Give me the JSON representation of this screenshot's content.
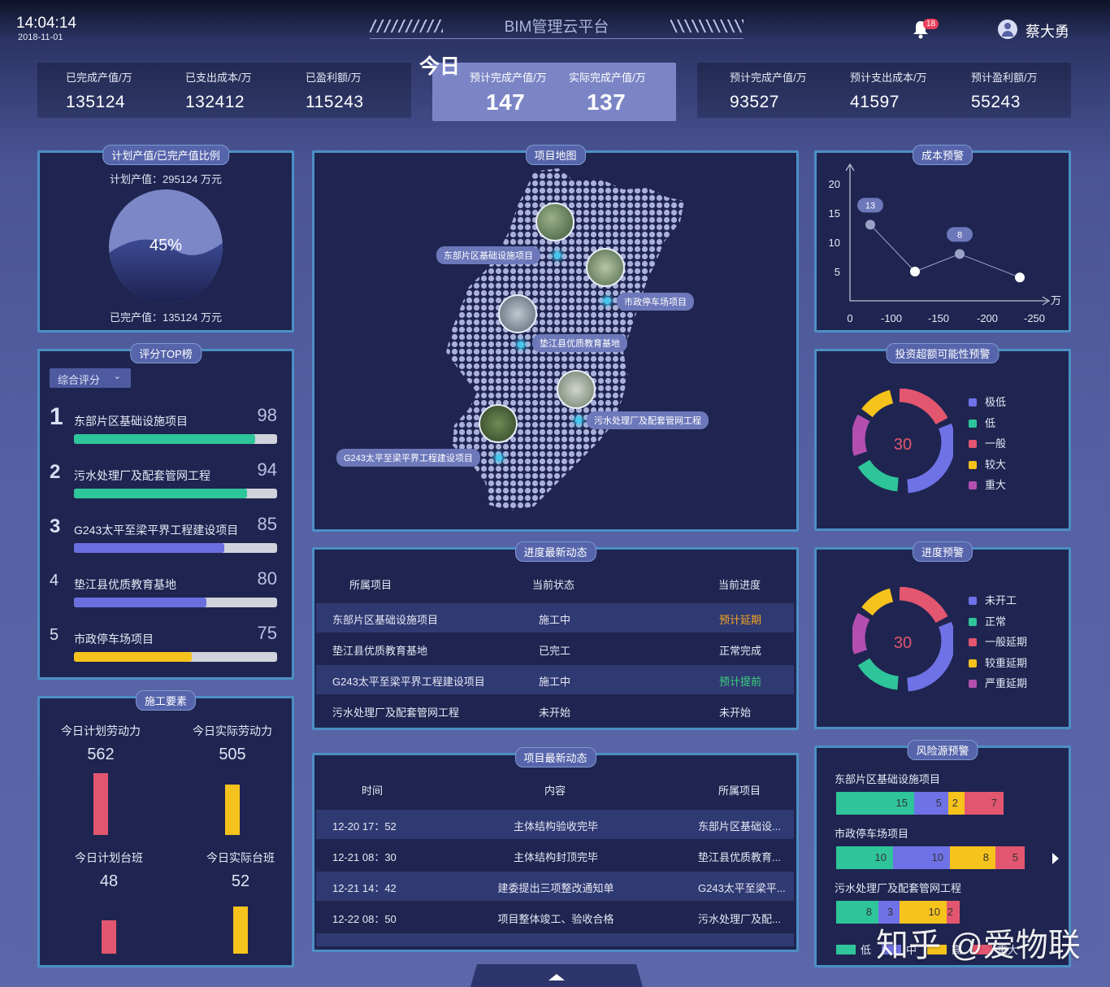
{
  "header": {
    "time": "14:04:14",
    "date": "2018-11-01",
    "title": "BIM管理云平台",
    "notif_count": "18",
    "user": "蔡大勇"
  },
  "stats_left": [
    {
      "label": "已完成产值/万",
      "value": "135124"
    },
    {
      "label": "已支出成本/万",
      "value": "132412"
    },
    {
      "label": "已盈利额/万",
      "value": "115243"
    }
  ],
  "today": {
    "title": "今日",
    "items": [
      {
        "label": "预计完成产值/万",
        "value": "147"
      },
      {
        "label": "实际完成产值/万",
        "value": "137"
      }
    ]
  },
  "stats_right": [
    {
      "label": "预计完成产值/万",
      "value": "93527"
    },
    {
      "label": "预计支出成本/万",
      "value": "41597"
    },
    {
      "label": "预计盈利额/万",
      "value": "55243"
    }
  ],
  "ratio": {
    "title": "计划产值/已完产值比例",
    "plan": "计划产值：295124 万元",
    "done": "已完产值：135124 万元",
    "percent": "45%",
    "fraction": 0.45
  },
  "ranking": {
    "title": "评分TOP榜",
    "dropdown": "综合评分",
    "items": [
      {
        "no": "1",
        "name": "东部片区基础设施项目",
        "score": "98",
        "pct": 0.89,
        "color": "#2ec59a"
      },
      {
        "no": "2",
        "name": "污水处理厂及配套管网工程",
        "score": "94",
        "pct": 0.85,
        "color": "#2ec59a"
      },
      {
        "no": "3",
        "name": "G243太平至梁平界工程建设项目",
        "score": "85",
        "pct": 0.74,
        "color": "#6a6fe0"
      },
      {
        "no": "4",
        "name": "垫江县优质教育基地",
        "score": "80",
        "pct": 0.65,
        "color": "#6a6fe0"
      },
      {
        "no": "5",
        "name": "市政停车场项目",
        "score": "75",
        "pct": 0.58,
        "color": "#f6c31c"
      }
    ]
  },
  "labor": {
    "title": "施工要素",
    "items": [
      {
        "label": "今日计划劳动力",
        "value": "562",
        "frac": 1.0,
        "color": "#e3566f"
      },
      {
        "label": "今日实际劳动力",
        "value": "505",
        "frac": 0.82,
        "color": "#f6c31c"
      },
      {
        "label": "今日计划台班",
        "value": "48",
        "frac": 0.62,
        "color": "#e3566f"
      },
      {
        "label": "今日实际台班",
        "value": "52",
        "frac": 0.88,
        "color": "#f6c31c"
      }
    ]
  },
  "map": {
    "title": "项目地图",
    "labels": [
      "东部片区基础设施项目",
      "市政停车场项目",
      "垫江县优质教育基地",
      "污水处理厂及配套管网工程",
      "G243太平至梁平界工程建设项目"
    ]
  },
  "cost": {
    "title": "成本预警",
    "unit": "万",
    "chart_data": {
      "type": "line",
      "x": [
        0,
        -100,
        -150,
        -200,
        -250
      ],
      "y_ticks": [
        20,
        15,
        10,
        5
      ],
      "points": [
        {
          "x": -100,
          "y": 13,
          "label": "13"
        },
        {
          "x": -150,
          "y": 5
        },
        {
          "x": -200,
          "y": 8,
          "label": "8"
        },
        {
          "x": -250,
          "y": 4
        }
      ],
      "x_tick_labels": [
        "0",
        "-100",
        "-150",
        "-200",
        "-250"
      ],
      "ylim": [
        0,
        20
      ]
    }
  },
  "invest": {
    "title": "投资超额可能性预警",
    "center": "30",
    "legend": [
      {
        "name": "极低",
        "color": "#6f72e6"
      },
      {
        "name": "低",
        "color": "#2ec59a"
      },
      {
        "name": "一般",
        "color": "#e3566f"
      },
      {
        "name": "较大",
        "color": "#f6c31c"
      },
      {
        "name": "重大",
        "color": "#b44fb0"
      }
    ]
  },
  "progress_warn": {
    "title": "进度预警",
    "center": "30",
    "legend": [
      {
        "name": "未开工",
        "color": "#6f72e6"
      },
      {
        "name": "正常",
        "color": "#2ec59a"
      },
      {
        "name": "一般延期",
        "color": "#e3566f"
      },
      {
        "name": "较重延期",
        "color": "#f6c31c"
      },
      {
        "name": "严重延期",
        "color": "#b44fb0"
      }
    ]
  },
  "progress_news": {
    "title": "进度最新动态",
    "headers": [
      "所属项目",
      "当前状态",
      "当前进度"
    ],
    "rows": [
      {
        "project": "东部片区基础设施项目",
        "state": "施工中",
        "progress": "预计延期",
        "color": "#f6a623"
      },
      {
        "project": "垫江县优质教育基地",
        "state": "已完工",
        "progress": "正常完成",
        "color": "#e6e9f6"
      },
      {
        "project": "G243太平至梁平界工程建设项目",
        "state": "施工中",
        "progress": "预计提前",
        "color": "#39d37a"
      },
      {
        "project": "污水处理厂及配套管网工程",
        "state": "未开始",
        "progress": "未开始",
        "color": "#e6e9f6"
      }
    ]
  },
  "project_news": {
    "title": "项目最新动态",
    "headers": [
      "时间",
      "内容",
      "所属项目"
    ],
    "rows": [
      {
        "time": "12-20  17：52",
        "content": "主体结构验收完毕",
        "project": "东部片区基础设..."
      },
      {
        "time": "12-21  08：30",
        "content": "主体结构封顶完毕",
        "project": "垫江县优质教育..."
      },
      {
        "time": "12-21  14：42",
        "content": "建委提出三项整改通知单",
        "project": "G243太平至梁平..."
      },
      {
        "time": "12-22  08：50",
        "content": "项目整体竣工、验收合格",
        "project": "污水处理厂及配..."
      }
    ]
  },
  "risk": {
    "title": "风险源预警",
    "projects": [
      {
        "name": "东部片区基础设施项目",
        "segments": [
          {
            "v": "15",
            "w": 96,
            "c": "#2ec59a"
          },
          {
            "v": "5",
            "w": 42,
            "c": "#6f72e6"
          },
          {
            "v": "2",
            "w": 20,
            "c": "#f6c31c"
          },
          {
            "v": "7",
            "w": 48,
            "c": "#e3566f"
          }
        ]
      },
      {
        "name": "市政停车场项目",
        "segments": [
          {
            "v": "10",
            "w": 70,
            "c": "#2ec59a"
          },
          {
            "v": "10",
            "w": 70,
            "c": "#6f72e6"
          },
          {
            "v": "8",
            "w": 56,
            "c": "#f6c31c"
          },
          {
            "v": "5",
            "w": 36,
            "c": "#e3566f"
          }
        ]
      },
      {
        "name": "污水处理厂及配套管网工程",
        "segments": [
          {
            "v": "8",
            "w": 52,
            "c": "#2ec59a"
          },
          {
            "v": "3",
            "w": 26,
            "c": "#6f72e6"
          },
          {
            "v": "10",
            "w": 58,
            "c": "#f6c31c"
          },
          {
            "v": "2",
            "w": 16,
            "c": "#e3566f"
          }
        ]
      }
    ],
    "legend": [
      {
        "name": "低",
        "color": "#2ec59a"
      },
      {
        "name": "中",
        "color": "#6f72e6"
      },
      {
        "name": "高",
        "color": "#f6c31c"
      },
      {
        "name": "重大",
        "color": "#e3566f"
      }
    ]
  },
  "watermark": "知乎 @爱物联"
}
